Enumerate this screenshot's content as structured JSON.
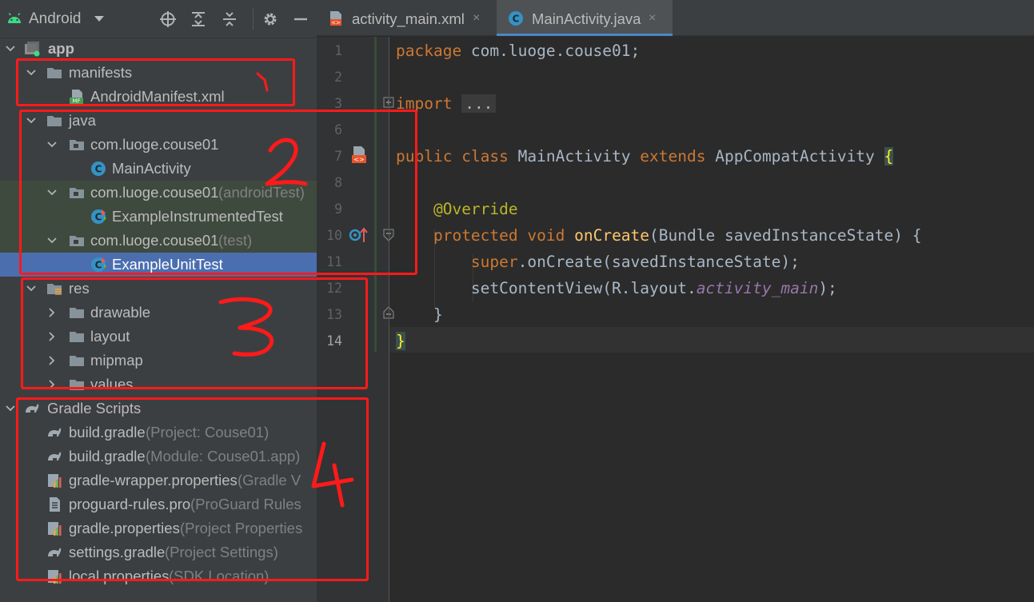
{
  "project_panel": {
    "view_title": "Android",
    "header_buttons": [
      "locate-icon",
      "expand-all-icon",
      "collapse-all-icon",
      "gear-icon",
      "hide-icon"
    ],
    "tree": [
      {
        "label": "app",
        "hint": "",
        "icon": "module-icon",
        "expanded": true
      },
      {
        "label": "manifests",
        "hint": "",
        "icon": "folder-icon",
        "expanded": true
      },
      {
        "label": "AndroidManifest.xml",
        "hint": "",
        "icon": "manifest-file-icon"
      },
      {
        "label": "java",
        "hint": "",
        "icon": "folder-icon",
        "expanded": true
      },
      {
        "label": "com.luoge.couse01",
        "hint": "",
        "icon": "package-icon",
        "expanded": true
      },
      {
        "label": "MainActivity",
        "hint": "",
        "icon": "class-icon"
      },
      {
        "label": "com.luoge.couse01",
        "hint": " (androidTest)",
        "icon": "package-icon",
        "expanded": true
      },
      {
        "label": "ExampleInstrumentedTest",
        "hint": "",
        "icon": "test-class-icon"
      },
      {
        "label": "com.luoge.couse01",
        "hint": " (test)",
        "icon": "package-icon",
        "expanded": true
      },
      {
        "label": "ExampleUnitTest",
        "hint": "",
        "icon": "test-class-icon"
      },
      {
        "label": "res",
        "hint": "",
        "icon": "res-folder-icon",
        "expanded": true
      },
      {
        "label": "drawable",
        "hint": "",
        "icon": "folder-icon",
        "expanded": false
      },
      {
        "label": "layout",
        "hint": "",
        "icon": "folder-icon",
        "expanded": false
      },
      {
        "label": "mipmap",
        "hint": "",
        "icon": "folder-icon",
        "expanded": false
      },
      {
        "label": "values",
        "hint": "",
        "icon": "folder-icon",
        "expanded": false
      },
      {
        "label": "Gradle Scripts",
        "hint": "",
        "icon": "gradle-icon",
        "expanded": true
      },
      {
        "label": "build.gradle",
        "hint": " (Project: Couse01)",
        "icon": "gradle-icon"
      },
      {
        "label": "build.gradle",
        "hint": " (Module: Couse01.app)",
        "icon": "gradle-icon"
      },
      {
        "label": "gradle-wrapper.properties",
        "hint": " (Gradle V",
        "icon": "properties-icon"
      },
      {
        "label": "proguard-rules.pro",
        "hint": " (ProGuard Rules",
        "icon": "text-file-icon"
      },
      {
        "label": "gradle.properties",
        "hint": " (Project Properties",
        "icon": "properties-icon"
      },
      {
        "label": "settings.gradle",
        "hint": " (Project Settings)",
        "icon": "gradle-icon"
      },
      {
        "label": "local.properties",
        "hint": " (SDK Location)",
        "icon": "properties-icon"
      }
    ],
    "selected_index": 9
  },
  "editor": {
    "tabs": [
      {
        "label": "activity_main.xml",
        "icon": "xml-file-icon",
        "active": false
      },
      {
        "label": "MainActivity.java",
        "icon": "class-icon",
        "active": true
      }
    ],
    "close_glyph": "×",
    "line_numbers": [
      "1",
      "2",
      "3",
      "6",
      "7",
      "8",
      "9",
      "10",
      "11",
      "12",
      "13",
      "14"
    ],
    "code": {
      "l1_kw": "package",
      "l1_rest": " com.luoge.couse01;",
      "l3_kw": "import",
      "l3_fold": "...",
      "l7_kw1": "public",
      "l7_kw2": "class",
      "l7_name": " MainActivity ",
      "l7_kw3": "extends",
      "l7_super": " AppCompatActivity ",
      "l7_brace": "{",
      "l9_ann": "@Override",
      "l10_kw1": "protected",
      "l10_kw2": "void",
      "l10_fn": "onCreate",
      "l10_rest": "(Bundle savedInstanceState) {",
      "l11_kw": "super",
      "l11_rest": ".onCreate(savedInstanceState);",
      "l12_pre": "setContentView(R.layout.",
      "l12_field": "activity_main",
      "l12_post": ");",
      "l13": "}",
      "l14_brace": "}"
    }
  },
  "annotations": {
    "labels": [
      "1",
      "2",
      "3",
      "4"
    ],
    "color": "#ff1a1a"
  },
  "colors": {
    "panel_bg": "#3c3f41",
    "editor_bg": "#2b2b2b",
    "selection": "#4b6eaf",
    "keyword": "#cc7832",
    "annotation": "#bbb529",
    "method": "#ffc66d",
    "field": "#9876aa"
  }
}
